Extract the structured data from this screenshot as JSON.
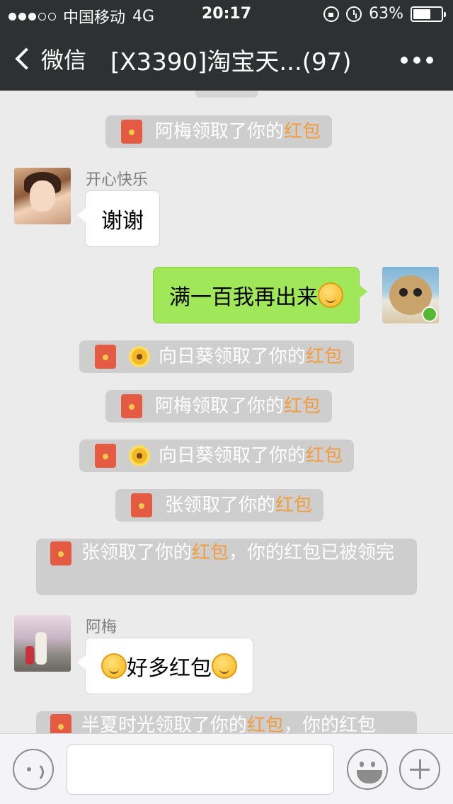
{
  "status_bar": {
    "carrier": "中国移动",
    "network": "4G",
    "time": "20:17",
    "battery": "63%",
    "battery_level": 0.63,
    "signal_bars_filled": 3,
    "signal_bars_total": 5
  },
  "nav": {
    "back_label": "微信",
    "title": "[X3390]淘宝天...(97)"
  },
  "messages": {
    "sys1": {
      "before": "阿梅领取了你的",
      "highlight": "红包"
    },
    "m1": {
      "sender": "开心快乐",
      "text": "谢谢"
    },
    "m2": {
      "text": "满一百我再出来"
    },
    "sys2": {
      "before": "向日葵领取了你的",
      "highlight": "红包"
    },
    "sys3": {
      "before": "阿梅领取了你的",
      "highlight": "红包"
    },
    "sys4": {
      "before": "向日葵领取了你的",
      "highlight": "红包"
    },
    "sys5": {
      "before": "张领取了你的",
      "highlight": "红包"
    },
    "sys6": {
      "before": "张领取了你的",
      "highlight": "红包",
      "after": "，你的红包已被领完"
    },
    "m3": {
      "sender": "阿梅",
      "text": "好多红包"
    },
    "sys7": {
      "before": "半夏时光领取了你的",
      "highlight": "红包",
      "after": "，你的红包"
    }
  },
  "colors": {
    "nav_bg": "#2e3132",
    "chat_bg": "#ebebeb",
    "outgoing_bubble": "#a0e75a",
    "red_packet": "#e55a42",
    "highlight": "#f39c3c"
  },
  "icons": {
    "back": "chevron-left-icon",
    "more": "more-dots-icon",
    "red_packet": "red-packet-icon",
    "voice": "voice-icon",
    "emoji": "emoji-icon",
    "plus": "plus-icon"
  }
}
